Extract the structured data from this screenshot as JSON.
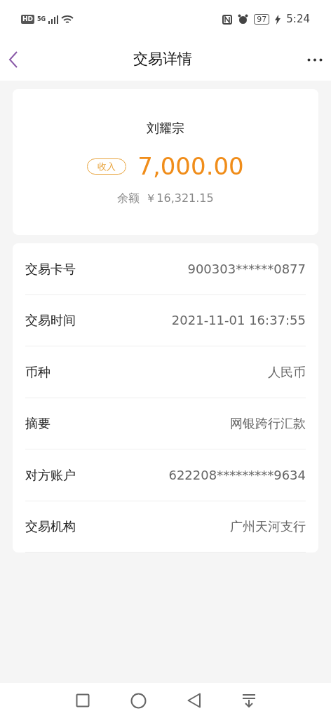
{
  "status_bar": {
    "hd": "HD",
    "network": "5G",
    "battery": "97",
    "time": "5:24"
  },
  "header": {
    "title": "交易详情"
  },
  "summary": {
    "name": "刘耀宗",
    "tag": "收入",
    "amount": "7,000.00",
    "balance_label": "余额",
    "balance": "￥16,321.15"
  },
  "details": [
    {
      "label": "交易卡号",
      "value": "900303******0877"
    },
    {
      "label": "交易时间",
      "value": "2021-11-01 16:37:55"
    },
    {
      "label": "币种",
      "value": "人民币"
    },
    {
      "label": "摘要",
      "value": "网银跨行汇款"
    },
    {
      "label": "对方账户",
      "value": "622208*********9634"
    },
    {
      "label": "交易机构",
      "value": "广州天河支行"
    }
  ]
}
